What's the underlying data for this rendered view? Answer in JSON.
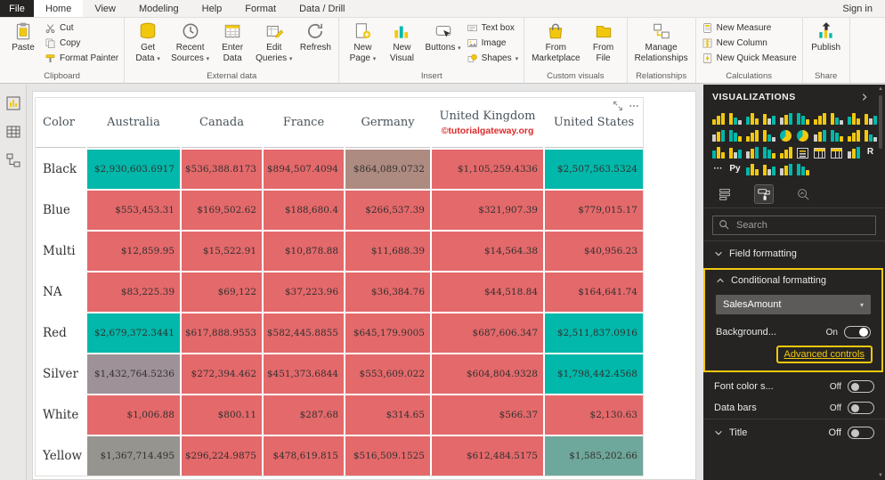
{
  "titlebar": {
    "file_label": "File",
    "tabs": [
      "Home",
      "View",
      "Modeling",
      "Help",
      "Format",
      "Data / Drill"
    ],
    "sign_in": "Sign in"
  },
  "ribbon": {
    "groups": [
      {
        "label": "Clipboard",
        "items": [
          {
            "label": "Paste",
            "icon": "clipboard",
            "size": "big"
          },
          {
            "label": "Cut",
            "icon": "scissors",
            "size": "small"
          },
          {
            "label": "Copy",
            "icon": "copy",
            "size": "small"
          },
          {
            "label": "Format Painter",
            "icon": "paintbrush",
            "size": "small"
          }
        ]
      },
      {
        "label": "External data",
        "items": [
          {
            "label": "Get\nData",
            "icon": "database",
            "size": "big",
            "dropdown": true
          },
          {
            "label": "Recent\nSources",
            "icon": "recent",
            "size": "big",
            "dropdown": true
          },
          {
            "label": "Enter\nData",
            "icon": "table-new",
            "size": "big"
          },
          {
            "label": "Edit\nQueries",
            "icon": "edit-table",
            "size": "big",
            "dropdown": true
          },
          {
            "label": "Refresh",
            "icon": "refresh",
            "size": "big"
          }
        ]
      },
      {
        "label": "Insert",
        "items": [
          {
            "label": "New\nPage",
            "icon": "new-page",
            "size": "big",
            "dropdown": true
          },
          {
            "label": "New\nVisual",
            "icon": "chart",
            "size": "big"
          },
          {
            "label": "Buttons",
            "icon": "button",
            "size": "big",
            "dropdown": true
          },
          {
            "label": "Text box",
            "icon": "textbox",
            "size": "small"
          },
          {
            "label": "Image",
            "icon": "image",
            "size": "small"
          },
          {
            "label": "Shapes",
            "icon": "shapes",
            "size": "small",
            "dropdown": true
          }
        ]
      },
      {
        "label": "Custom visuals",
        "items": [
          {
            "label": "From\nMarketplace",
            "icon": "marketplace",
            "size": "big"
          },
          {
            "label": "From\nFile",
            "icon": "file",
            "size": "big"
          }
        ]
      },
      {
        "label": "Relationships",
        "items": [
          {
            "label": "Manage\nRelationships",
            "icon": "relationships",
            "size": "big"
          }
        ]
      },
      {
        "label": "Calculations",
        "items": [
          {
            "label": "New Measure",
            "icon": "measure",
            "size": "small"
          },
          {
            "label": "New Column",
            "icon": "column",
            "size": "small"
          },
          {
            "label": "New Quick Measure",
            "icon": "quick-measure",
            "size": "small"
          }
        ]
      },
      {
        "label": "Share",
        "items": [
          {
            "label": "Publish",
            "icon": "publish",
            "size": "big"
          }
        ]
      }
    ]
  },
  "matrix": {
    "columns": [
      "Color",
      "Australia",
      "Canada",
      "France",
      "Germany",
      "United Kingdom",
      "United States"
    ],
    "watermark": "©tutorialgateway.org",
    "palette": {
      "teal": "#01B8AA",
      "red": "#E4696B",
      "tan": "#AE8B81",
      "mauve": "#9E9198",
      "gray": "#95948F",
      "grayteal": "#6EA79B"
    },
    "rows": [
      {
        "label": "Black",
        "cells": [
          {
            "v": "$2,930,603.6917",
            "c": "teal"
          },
          {
            "v": "$536,388.8173",
            "c": "red"
          },
          {
            "v": "$894,507.4094",
            "c": "red"
          },
          {
            "v": "$864,089.0732",
            "c": "tan"
          },
          {
            "v": "$1,105,259.4336",
            "c": "red"
          },
          {
            "v": "$2,507,563.5324",
            "c": "teal"
          }
        ]
      },
      {
        "label": "Blue",
        "cells": [
          {
            "v": "$553,453.31",
            "c": "red"
          },
          {
            "v": "$169,502.62",
            "c": "red"
          },
          {
            "v": "$188,680.4",
            "c": "red"
          },
          {
            "v": "$266,537.39",
            "c": "red"
          },
          {
            "v": "$321,907.39",
            "c": "red"
          },
          {
            "v": "$779,015.17",
            "c": "red"
          }
        ]
      },
      {
        "label": "Multi",
        "cells": [
          {
            "v": "$12,859.95",
            "c": "red"
          },
          {
            "v": "$15,522.91",
            "c": "red"
          },
          {
            "v": "$10,878.88",
            "c": "red"
          },
          {
            "v": "$11,688.39",
            "c": "red"
          },
          {
            "v": "$14,564.38",
            "c": "red"
          },
          {
            "v": "$40,956.23",
            "c": "red"
          }
        ]
      },
      {
        "label": "NA",
        "cells": [
          {
            "v": "$83,225.39",
            "c": "red"
          },
          {
            "v": "$69,122",
            "c": "red"
          },
          {
            "v": "$37,223.96",
            "c": "red"
          },
          {
            "v": "$36,384.76",
            "c": "red"
          },
          {
            "v": "$44,518.84",
            "c": "red"
          },
          {
            "v": "$164,641.74",
            "c": "red"
          }
        ]
      },
      {
        "label": "Red",
        "cells": [
          {
            "v": "$2,679,372.3441",
            "c": "teal"
          },
          {
            "v": "$617,888.9553",
            "c": "red"
          },
          {
            "v": "$582,445.8855",
            "c": "red"
          },
          {
            "v": "$645,179.9005",
            "c": "red"
          },
          {
            "v": "$687,606.347",
            "c": "red"
          },
          {
            "v": "$2,511,837.0916",
            "c": "teal"
          }
        ]
      },
      {
        "label": "Silver",
        "cells": [
          {
            "v": "$1,432,764.5236",
            "c": "mauve"
          },
          {
            "v": "$272,394.462",
            "c": "red"
          },
          {
            "v": "$451,373.6844",
            "c": "red"
          },
          {
            "v": "$553,609.022",
            "c": "red"
          },
          {
            "v": "$604,804.9328",
            "c": "red"
          },
          {
            "v": "$1,798,442.4568",
            "c": "teal"
          }
        ]
      },
      {
        "label": "White",
        "cells": [
          {
            "v": "$1,006.88",
            "c": "red"
          },
          {
            "v": "$800.11",
            "c": "red"
          },
          {
            "v": "$287.68",
            "c": "red"
          },
          {
            "v": "$314.65",
            "c": "red"
          },
          {
            "v": "$566.37",
            "c": "red"
          },
          {
            "v": "$2,130.63",
            "c": "red"
          }
        ]
      },
      {
        "label": "Yellow",
        "cells": [
          {
            "v": "$1,367,714.495",
            "c": "gray"
          },
          {
            "v": "$296,224.9875",
            "c": "red"
          },
          {
            "v": "$478,619.815",
            "c": "red"
          },
          {
            "v": "$516,509.1525",
            "c": "red"
          },
          {
            "v": "$612,484.5175",
            "c": "red"
          },
          {
            "v": "$1,585,202.66",
            "c": "grayteal"
          }
        ]
      }
    ]
  },
  "visualizations": {
    "title": "VISUALIZATIONS",
    "search_placeholder": "Search",
    "field_formatting": "Field formatting",
    "conditional_formatting": "Conditional formatting",
    "field_dropdown": "SalesAmount",
    "background_label": "Background...",
    "background_state": "On",
    "advanced_controls": "Advanced controls",
    "font_color_label": "Font color s...",
    "font_color_state": "Off",
    "data_bars_label": "Data bars",
    "data_bars_state": "Off",
    "title_label": "Title",
    "title_state": "Off",
    "icons": [
      "stacked-bar",
      "stacked-column",
      "clustered-bar",
      "clustered-column",
      "100-stacked-bar",
      "100-stacked-column",
      "line",
      "area",
      "stacked-area",
      "line-clustered-column",
      "line-stacked-column",
      "ribbon",
      "waterfall",
      "scatter",
      "pie",
      "donut",
      "treemap",
      "map",
      "filled-map",
      "shape-map",
      "funnel",
      "gauge",
      "card",
      "multi-row-card",
      "kpi",
      "slicer",
      "table",
      "matrix",
      "arcgis-map",
      "r-script",
      "ellipsis",
      "python",
      "paginated-report",
      "key-influencers",
      "qna",
      "custom-visual"
    ]
  },
  "colors": {
    "accent_yellow": "#F2C80F",
    "teal": "#01B8AA",
    "highlight": "#F2C80F",
    "panel_bg": "#252423"
  }
}
